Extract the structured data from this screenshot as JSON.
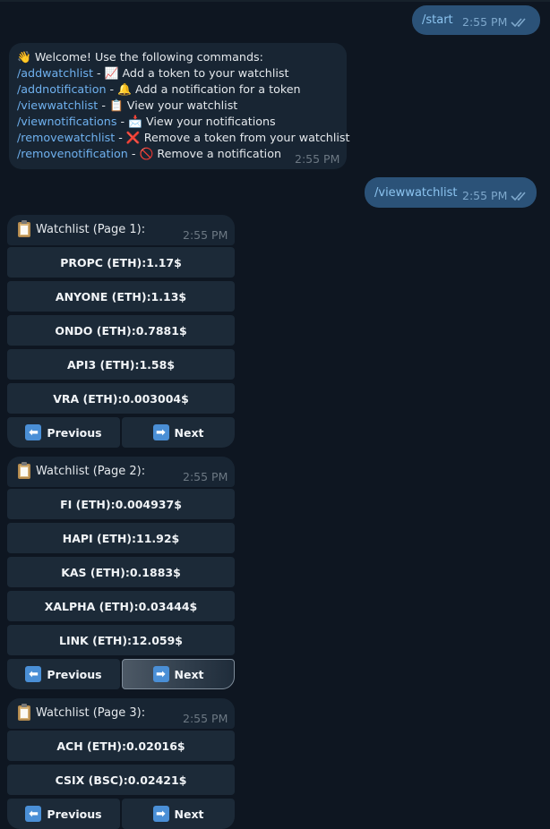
{
  "messages": {
    "start_cmd": "/start",
    "start_time": "2:55 PM",
    "viewwatchlist_cmd": "/viewwatchlist",
    "viewwatchlist_time": "2:55 PM"
  },
  "welcome": {
    "intro": "Welcome! Use the following commands:",
    "time": "2:55 PM",
    "commands": [
      {
        "cmd": "/addwatchlist",
        "icon": "📈",
        "icon_name": "chart-increasing-icon",
        "desc": "Add a token to your watchlist"
      },
      {
        "cmd": "/addnotification",
        "icon": "🔔",
        "icon_name": "bell-icon",
        "desc": "Add a notification for a token"
      },
      {
        "cmd": "/viewwatchlist",
        "icon": "📋",
        "icon_name": "clipboard-icon",
        "desc": "View your watchlist"
      },
      {
        "cmd": "/viewnotifications",
        "icon": "📩",
        "icon_name": "envelope-icon",
        "desc": "View your notifications"
      },
      {
        "cmd": "/removewatchlist",
        "icon": "❌",
        "icon_name": "cross-mark-icon",
        "desc": "Remove a token from your watchlist"
      },
      {
        "cmd": "/removenotification",
        "icon": "🚫",
        "icon_name": "prohibited-icon",
        "desc": "Remove a notification"
      }
    ]
  },
  "pages": [
    {
      "title": "Watchlist (Page 1):",
      "time": "2:55 PM",
      "tokens": [
        "PROPC (ETH):1.17$",
        "ANYONE (ETH):1.13$",
        "ONDO (ETH):0.7881$",
        "API3 (ETH):1.58$",
        "VRA (ETH):0.003004$"
      ],
      "prev_label": "Previous",
      "next_label": "Next"
    },
    {
      "title": "Watchlist (Page 2):",
      "time": "2:55 PM",
      "tokens": [
        "FI (ETH):0.004937$",
        "HAPI (ETH):11.92$",
        "KAS (ETH):0.1883$",
        "XALPHA (ETH):0.03444$",
        "LINK (ETH):12.059$"
      ],
      "prev_label": "Previous",
      "next_label": "Next"
    },
    {
      "title": "Watchlist (Page 3):",
      "time": "2:55 PM",
      "tokens": [
        "ACH (ETH):0.02016$",
        "CSIX (BSC):0.02421$"
      ],
      "prev_label": "Previous",
      "next_label": "Next"
    }
  ],
  "colors": {
    "background": "#0e1621",
    "outgoing_bubble": "#2b5278",
    "incoming_bubble": "#182533",
    "link": "#6fb1ef"
  }
}
